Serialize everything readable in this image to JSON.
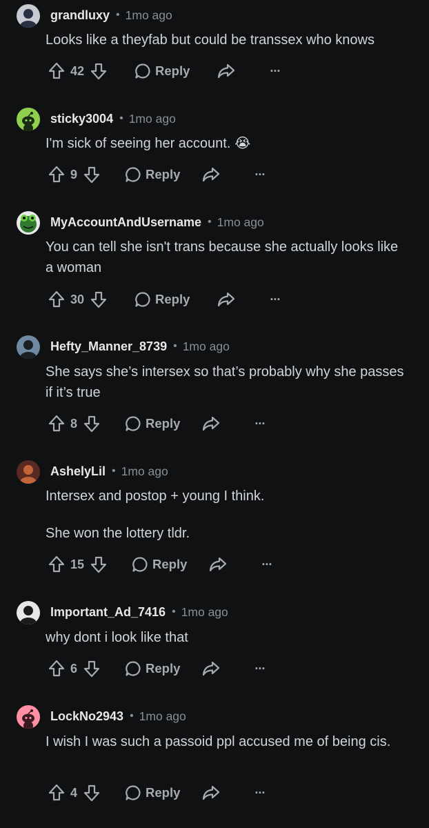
{
  "comments": [
    {
      "username": "grandluxy",
      "time": "1mo ago",
      "lines": [
        "Looks like a theyfab but could be transsex who knows"
      ],
      "votes": "42",
      "reply_label": "Reply",
      "avatar": {
        "type": "photo",
        "bg": "#c9cbd2",
        "accent": "#2b3142"
      }
    },
    {
      "username": "sticky3004",
      "time": "1mo ago",
      "lines": [
        "I'm sick of seeing her account. 😭"
      ],
      "votes": "9",
      "reply_label": "Reply",
      "avatar": {
        "type": "snoo",
        "bg": "#8fd14f",
        "accent": "#1b2a12"
      }
    },
    {
      "username": "MyAccountAndUsername",
      "time": "1mo ago",
      "lines": [
        "You can tell she isn't trans because she actually looks like a woman"
      ],
      "votes": "30",
      "reply_label": "Reply",
      "avatar": {
        "type": "frog",
        "bg": "#2f7a2f",
        "accent": "#6fcf4b"
      }
    },
    {
      "username": "Hefty_Manner_8739",
      "time": "1mo ago",
      "lines": [
        "She says she’s intersex so that’s probably why she passes if it’s true"
      ],
      "votes": "8",
      "reply_label": "Reply",
      "avatar": {
        "type": "photo",
        "bg": "#6f8aa0",
        "accent": "#1a1f24"
      }
    },
    {
      "username": "AshelyLil",
      "time": "1mo ago",
      "lines": [
        "Intersex and postop + young I think.",
        "",
        "She won the lottery tldr."
      ],
      "votes": "15",
      "reply_label": "Reply",
      "avatar": {
        "type": "photo",
        "bg": "#5a2a22",
        "accent": "#c0643a"
      }
    },
    {
      "username": "Important_Ad_7416",
      "time": "1mo ago",
      "lines": [
        "why dont i look like that"
      ],
      "votes": "6",
      "reply_label": "Reply",
      "avatar": {
        "type": "photo",
        "bg": "#e9e6e6",
        "accent": "#1c1c1c"
      }
    },
    {
      "username": "LockNo2943",
      "time": "1mo ago",
      "lines": [
        "I wish I was such a passoid ppl accused me of being cis."
      ],
      "votes": "4",
      "reply_label": "Reply",
      "avatar": {
        "type": "snoo",
        "bg": "#ff8fa3",
        "accent": "#3a1a22"
      }
    }
  ]
}
